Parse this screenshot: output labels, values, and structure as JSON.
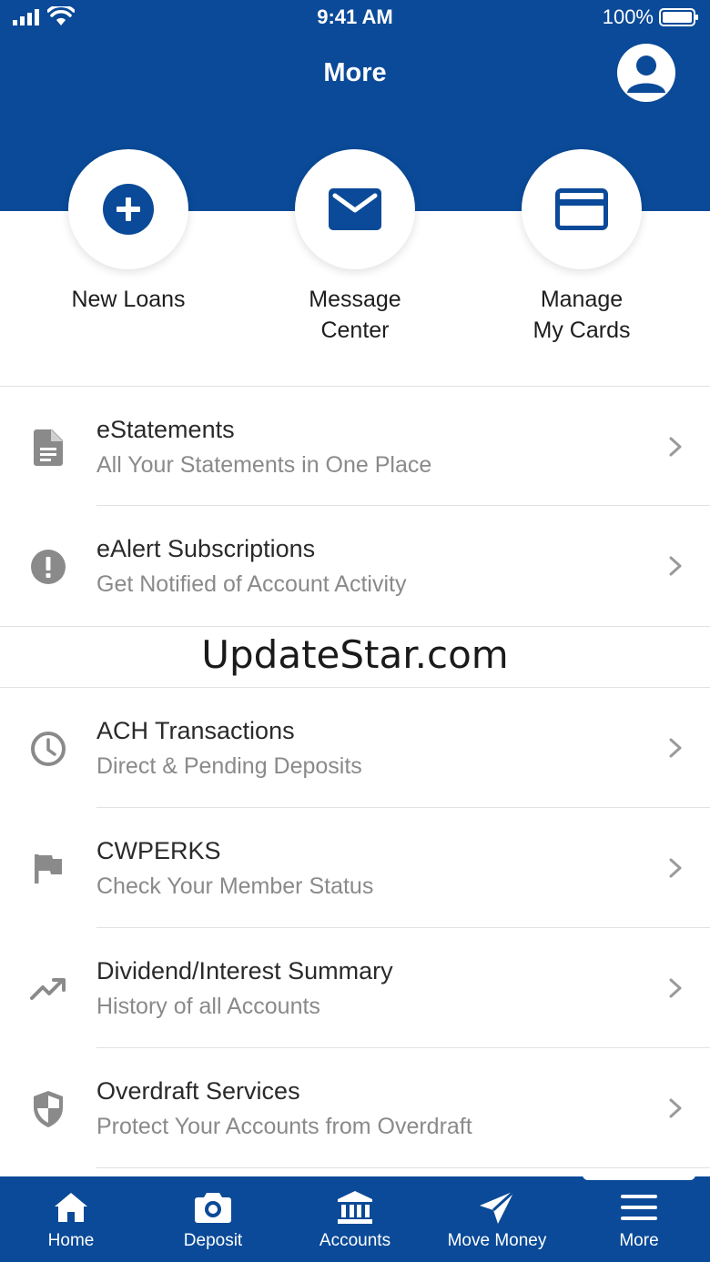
{
  "status_bar": {
    "time": "9:41 AM",
    "battery_percent": "100%"
  },
  "header": {
    "title": "More"
  },
  "quick_actions": [
    {
      "label_line1": "New Loans",
      "label_line2": "",
      "icon": "plus-circle-icon"
    },
    {
      "label_line1": "Message",
      "label_line2": "Center",
      "icon": "envelope-icon"
    },
    {
      "label_line1": "Manage",
      "label_line2": "My Cards",
      "icon": "credit-card-icon"
    }
  ],
  "menu_items": [
    {
      "title": "eStatements",
      "subtitle": "All Your Statements in One Place",
      "icon": "document-icon"
    },
    {
      "title": "eAlert Subscriptions",
      "subtitle": "Get Notified of Account Activity",
      "icon": "alert-icon"
    },
    {
      "title": "ACH Transactions",
      "subtitle": "Direct & Pending Deposits",
      "icon": "clock-icon"
    },
    {
      "title": "CWPERKS",
      "subtitle": "Check Your Member Status",
      "icon": "flag-icon"
    },
    {
      "title": "Dividend/Interest Summary",
      "subtitle": "History of all Accounts",
      "icon": "trending-up-icon"
    },
    {
      "title": "Overdraft Services",
      "subtitle": "Protect Your Accounts from Overdraft",
      "icon": "shield-icon"
    }
  ],
  "watermark": "UpdateStar.com",
  "tab_bar": [
    {
      "label": "Home",
      "icon": "home-icon"
    },
    {
      "label": "Deposit",
      "icon": "camera-icon"
    },
    {
      "label": "Accounts",
      "icon": "bank-icon"
    },
    {
      "label": "Move Money",
      "icon": "send-icon"
    },
    {
      "label": "More",
      "icon": "menu-icon"
    }
  ],
  "colors": {
    "brand_blue": "#0a4a98",
    "icon_gray": "#8a8a8a",
    "subtitle_gray": "#8a8a8a"
  }
}
